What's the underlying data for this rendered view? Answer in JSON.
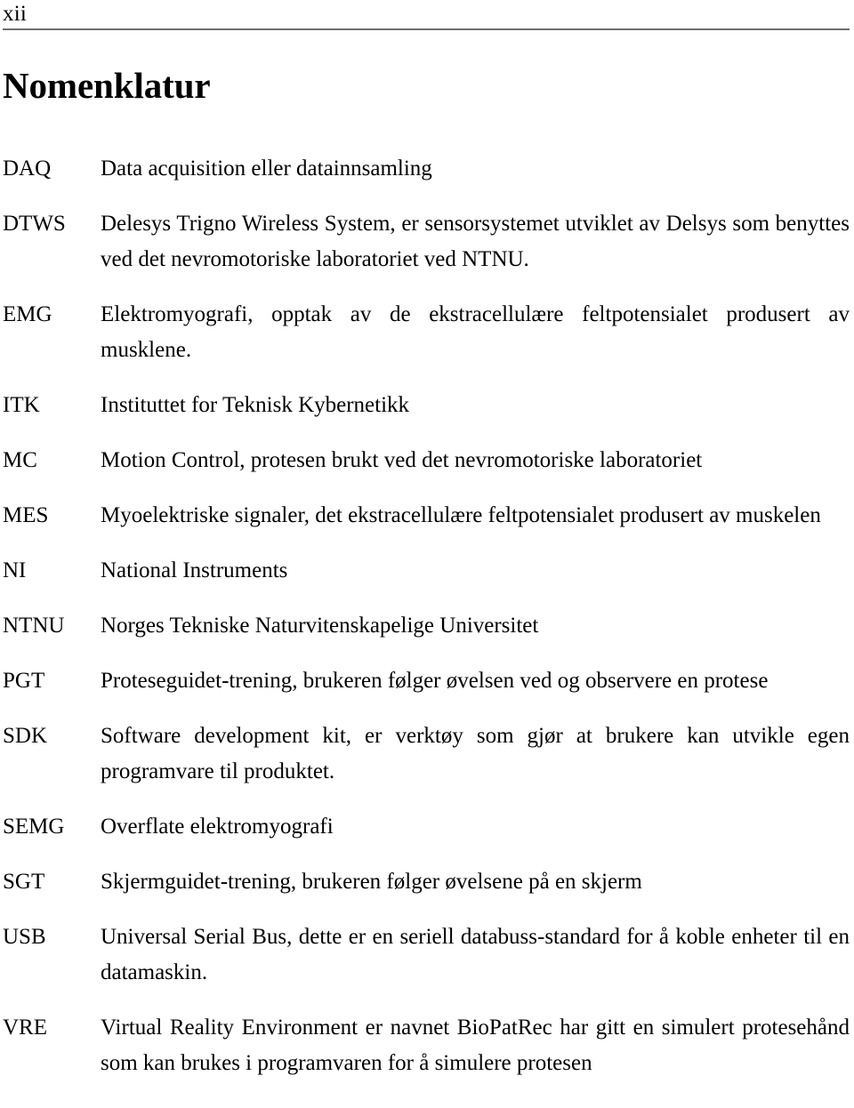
{
  "header": {
    "folio": "xii",
    "rule_color": "#6e6e6e"
  },
  "title": "Nomenklatur",
  "glossary": {
    "entries": [
      {
        "term": "DAQ",
        "definition": "Data acquisition eller datainnsamling"
      },
      {
        "term": "DTWS",
        "definition": "Delesys Trigno Wireless System, er sensorsystemet utviklet av Delsys som benyttes ved det nevromotoriske laboratoriet ved NTNU."
      },
      {
        "term": "EMG",
        "definition": "Elektromyografi, opptak av de ekstracellulære feltpotensialet produsert av musklene."
      },
      {
        "term": "ITK",
        "definition": "Instituttet for Teknisk Kybernetikk"
      },
      {
        "term": "MC",
        "definition": "Motion Control, protesen brukt ved det nevromotoriske laboratoriet"
      },
      {
        "term": "MES",
        "definition": "Myoelektriske signaler, det ekstracellulære feltpotensialet produsert av muskelen"
      },
      {
        "term": "NI",
        "definition": "National Instruments"
      },
      {
        "term": "NTNU",
        "definition": "Norges Tekniske Naturvitenskapelige Universitet"
      },
      {
        "term": "PGT",
        "definition": "Proteseguidet-trening, brukeren følger øvelsen ved og observere en protese"
      },
      {
        "term": "SDK",
        "definition": "Software development kit, er verktøy som gjør at brukere kan utvikle egen programvare til produktet."
      },
      {
        "term": "SEMG",
        "definition": "Overflate elektromyografi"
      },
      {
        "term": "SGT",
        "definition": "Skjermguidet-trening, brukeren følger øvelsene på en skjerm"
      },
      {
        "term": "USB",
        "definition": "Universal Serial Bus, dette er en seriell databuss-standard for å koble enheter til en datamaskin."
      },
      {
        "term": "VRE",
        "definition": "Virtual Reality Environment er navnet BioPatRec har gitt en simulert protesehånd som kan brukes i programvaren for å simulere protesen"
      }
    ]
  }
}
